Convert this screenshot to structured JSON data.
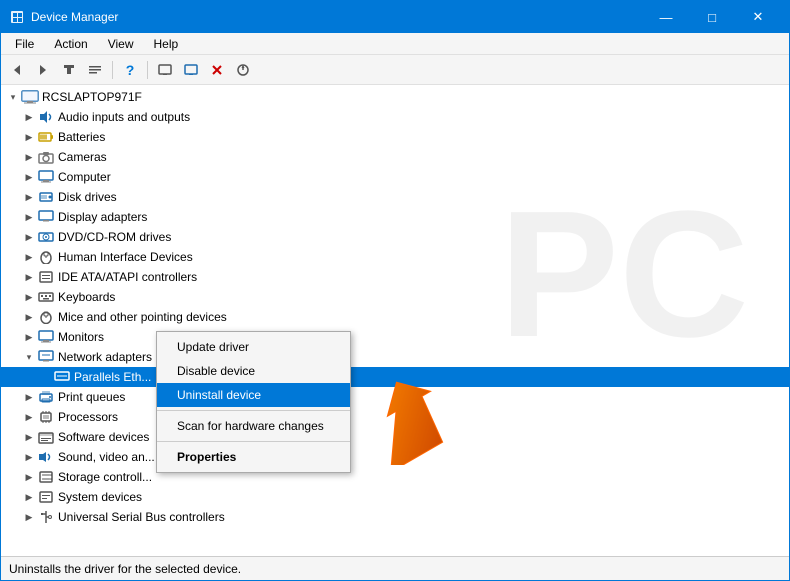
{
  "window": {
    "title": "Device Manager",
    "icon": "⚙"
  },
  "titlebar": {
    "minimize": "—",
    "maximize": "□",
    "close": "✕"
  },
  "menu": {
    "items": [
      "File",
      "Action",
      "View",
      "Help"
    ]
  },
  "toolbar": {
    "buttons": [
      "◀",
      "▶",
      "☰",
      "≡",
      "?",
      "⬛",
      "🖥",
      "⬜",
      "✕",
      "⬇"
    ]
  },
  "tree": {
    "root": {
      "label": "RCSLAPTOP971F",
      "expanded": true
    },
    "items": [
      {
        "id": "audio",
        "label": "Audio inputs and outputs",
        "icon": "audio",
        "indent": 1
      },
      {
        "id": "batteries",
        "label": "Batteries",
        "icon": "battery",
        "indent": 1
      },
      {
        "id": "cameras",
        "label": "Cameras",
        "icon": "camera",
        "indent": 1
      },
      {
        "id": "computer",
        "label": "Computer",
        "icon": "computer",
        "indent": 1
      },
      {
        "id": "disk",
        "label": "Disk drives",
        "icon": "disk",
        "indent": 1
      },
      {
        "id": "display",
        "label": "Display adapters",
        "icon": "display",
        "indent": 1
      },
      {
        "id": "dvd",
        "label": "DVD/CD-ROM drives",
        "icon": "dvd",
        "indent": 1
      },
      {
        "id": "hid",
        "label": "Human Interface Devices",
        "icon": "hid",
        "indent": 1
      },
      {
        "id": "ide",
        "label": "IDE ATA/ATAPI controllers",
        "icon": "ide",
        "indent": 1
      },
      {
        "id": "keyboards",
        "label": "Keyboards",
        "icon": "keyboard",
        "indent": 1
      },
      {
        "id": "mice",
        "label": "Mice and other pointing devices",
        "icon": "mouse",
        "indent": 1
      },
      {
        "id": "monitors",
        "label": "Monitors",
        "icon": "monitor",
        "indent": 1
      },
      {
        "id": "network",
        "label": "Network adapters",
        "icon": "network",
        "indent": 1,
        "expanded": true
      },
      {
        "id": "parallels",
        "label": "Parallels Eth...",
        "icon": "network-sub",
        "indent": 2
      },
      {
        "id": "print",
        "label": "Print queues",
        "icon": "print",
        "indent": 1
      },
      {
        "id": "processors",
        "label": "Processors",
        "icon": "processor",
        "indent": 1
      },
      {
        "id": "software",
        "label": "Software devices",
        "icon": "software",
        "indent": 1
      },
      {
        "id": "sound",
        "label": "Sound, video an...",
        "icon": "sound",
        "indent": 1
      },
      {
        "id": "storage",
        "label": "Storage controll...",
        "icon": "storage",
        "indent": 1
      },
      {
        "id": "system",
        "label": "System devices",
        "icon": "system",
        "indent": 1
      },
      {
        "id": "usb",
        "label": "Universal Serial Bus controllers",
        "icon": "usb",
        "indent": 1
      }
    ]
  },
  "context_menu": {
    "items": [
      {
        "id": "update-driver",
        "label": "Update driver",
        "bold": false,
        "highlighted": false,
        "sep_after": false
      },
      {
        "id": "disable-device",
        "label": "Disable device",
        "bold": false,
        "highlighted": false,
        "sep_after": false
      },
      {
        "id": "uninstall-device",
        "label": "Uninstall device",
        "bold": false,
        "highlighted": true,
        "sep_after": true
      },
      {
        "id": "scan-changes",
        "label": "Scan for hardware changes",
        "bold": false,
        "highlighted": false,
        "sep_after": true
      },
      {
        "id": "properties",
        "label": "Properties",
        "bold": true,
        "highlighted": false,
        "sep_after": false
      }
    ]
  },
  "status_bar": {
    "text": "Uninstalls the driver for the selected device."
  },
  "icons": {
    "audio": "🔊",
    "battery": "🔋",
    "camera": "📷",
    "computer": "🖥",
    "disk": "💾",
    "display": "🖥",
    "dvd": "💿",
    "hid": "🖱",
    "ide": "🔌",
    "keyboard": "⌨",
    "mouse": "🖱",
    "monitor": "🖥",
    "network": "🌐",
    "network-sub": "🌐",
    "print": "🖨",
    "processor": "🔲",
    "software": "📁",
    "sound": "🎵",
    "storage": "💾",
    "system": "⚙",
    "usb": "🔌"
  }
}
